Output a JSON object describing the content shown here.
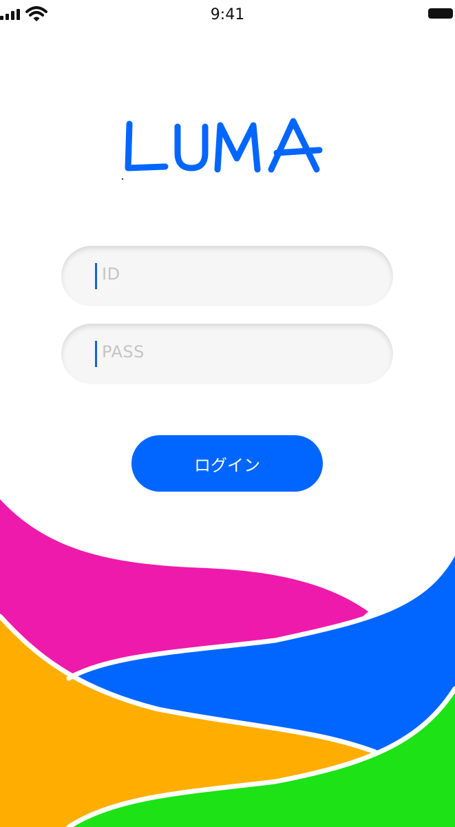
{
  "status_bar": {
    "time": "9:41",
    "icons": [
      "signal-icon",
      "wifi-icon",
      "battery-icon"
    ]
  },
  "logo": {
    "text": "LUMA",
    "color": "#0066ff"
  },
  "form": {
    "id_placeholder": "ID",
    "pass_placeholder": "PASS"
  },
  "login_button": {
    "label": "ログイン",
    "color": "#0066ff"
  },
  "wave_colors": {
    "magenta": "#ee1aab",
    "blue": "#0066ff",
    "orange": "#ffae00",
    "green": "#1de215"
  }
}
